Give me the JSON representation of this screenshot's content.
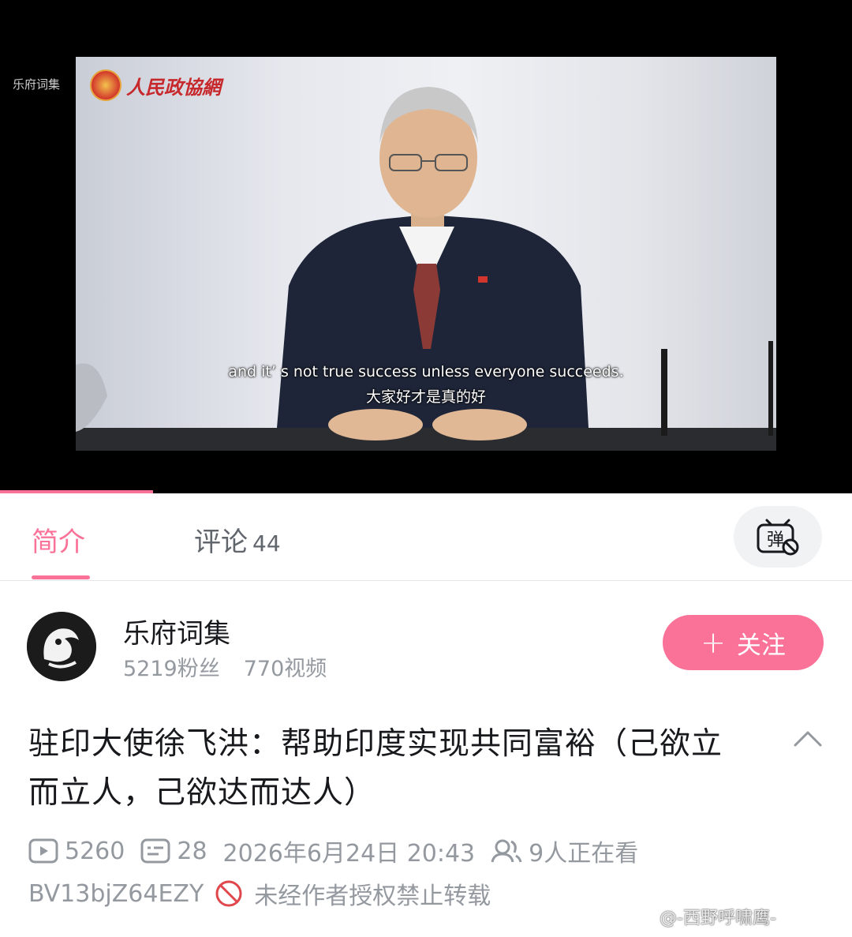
{
  "video": {
    "channel_watermark": "乐府词集",
    "logo_text": "人民政協網",
    "subtitle_en": "and it’  s not true success unless everyone succeeds.",
    "subtitle_zh": "大家好才是真的好",
    "progress_fraction": 0.18
  },
  "tabs": {
    "intro_label": "简介",
    "comments_label": "评论",
    "comments_count": "44",
    "danmaku_icon_text": "弹"
  },
  "uploader": {
    "name": "乐府词集",
    "followers": "5219粉丝",
    "videos": "770视频",
    "follow_label": "关注"
  },
  "video_info": {
    "title": "驻印大使徐飞洪：帮助印度实现共同富裕（己欲立而立人，己欲达而达人）",
    "views": "5260",
    "danmaku_count": "28",
    "publish_time": "2026年6月24日 20:43",
    "watching_now": "9人正在看",
    "bvid": "BV13bjZ64EZY",
    "copyright_notice": "未经作者授权禁止转载"
  },
  "watermark": {
    "weibo": "@-西野呼啸鹰-"
  },
  "colors": {
    "accent": "#fb7299",
    "muted": "#9499a0",
    "text": "#18191c"
  }
}
